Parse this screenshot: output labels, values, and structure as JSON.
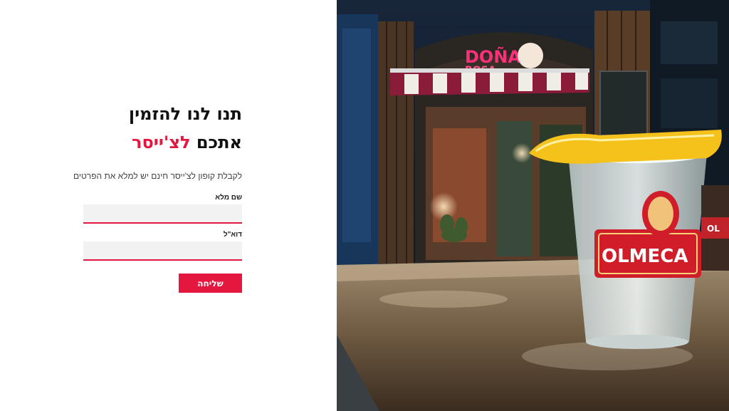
{
  "form": {
    "headline_line1": "תנו לנו להזמין",
    "headline_line2_part1": "אתכם",
    "headline_line2_accent": "לצ'ייסר",
    "subtext": "לקבלת קופון לצ'ייסר חינם יש למלא את הפרטים",
    "name_label": "שם מלא",
    "name_value": "",
    "email_label": "דוא\"ל",
    "email_value": "",
    "submit_label": "שליחה"
  },
  "photo": {
    "bar_sign": "DOÑA ROSA",
    "glass_brand": "OLMECA"
  },
  "colors": {
    "accent": "#e4173f",
    "text": "#111111",
    "input_bg": "#f2f2f2"
  }
}
